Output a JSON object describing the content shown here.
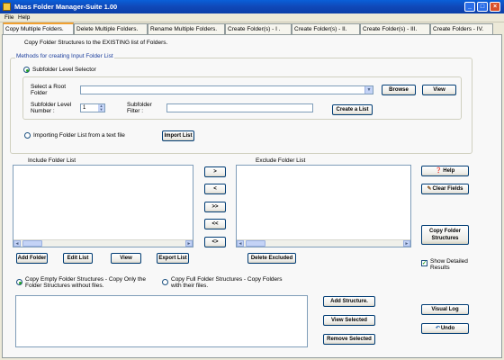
{
  "window": {
    "title": "Mass Folder Manager-Suite 1.00"
  },
  "menu": [
    "File",
    "Help"
  ],
  "tabs": [
    "Copy Multiple Folders.",
    "Delete Multiple Folders.",
    "Rename Multiple Folders.",
    "Create  Folder(s) - I .",
    "Create Folder(s)  - II.",
    "Create Folder(s)  - III.",
    "Create Folders - IV."
  ],
  "header_text": "Copy Folder Structures to the EXISTING list of Folders.",
  "methods": {
    "group_title": "Methods for creating Input Folder List",
    "option_subfolder": "Subfolder Level Selector",
    "root_label": "Select a Root Folder",
    "root_value": "",
    "browse": "Browse",
    "view": "View",
    "level_label": "Subfolder Level Number :",
    "level_value": "1",
    "filter_label": "Subfolder Filter :",
    "filter_value": "",
    "create_list": "Create a List",
    "option_import": "Importing Folder List from a text file",
    "import_list": "Import List"
  },
  "include": {
    "title": "Include Folder List",
    "add": "Add Folder",
    "edit": "Edit List",
    "view": "View",
    "export": "Export List"
  },
  "exclude": {
    "title": "Exclude Folder List",
    "delete": "Delete Excluded"
  },
  "move": {
    "right": ">",
    "left": "<",
    "all_right": ">>",
    "all_left": "<<",
    "swap": "<>"
  },
  "side": {
    "help": "Help",
    "clear": "Clear Fields",
    "copy": "Copy Folder Structures",
    "show_detailed": "Show Detailed Results",
    "show_detailed_checked": true
  },
  "copy_options": {
    "empty": "Copy Empty Folder Structures - Copy Only the Folder Structures without files.",
    "full": "Copy Full Folder Structures - Copy Folders with their files."
  },
  "bottom": {
    "add_structure": "Add  Structure.",
    "view_selected": "View Selected",
    "remove_selected": "Remove Selected",
    "visual_log": "Visual Log",
    "undo": "Undo"
  },
  "colors": {
    "title_bar": "#0b4fcf",
    "panel": "#f8f8f8",
    "window_bg": "#ece9d8",
    "group_title": "#1a3d9c",
    "button_border": "#003c74",
    "help_icon": "#2c6bb0",
    "clear_icon": "#8a5a2b",
    "undo_icon": "#2c6bb0"
  }
}
